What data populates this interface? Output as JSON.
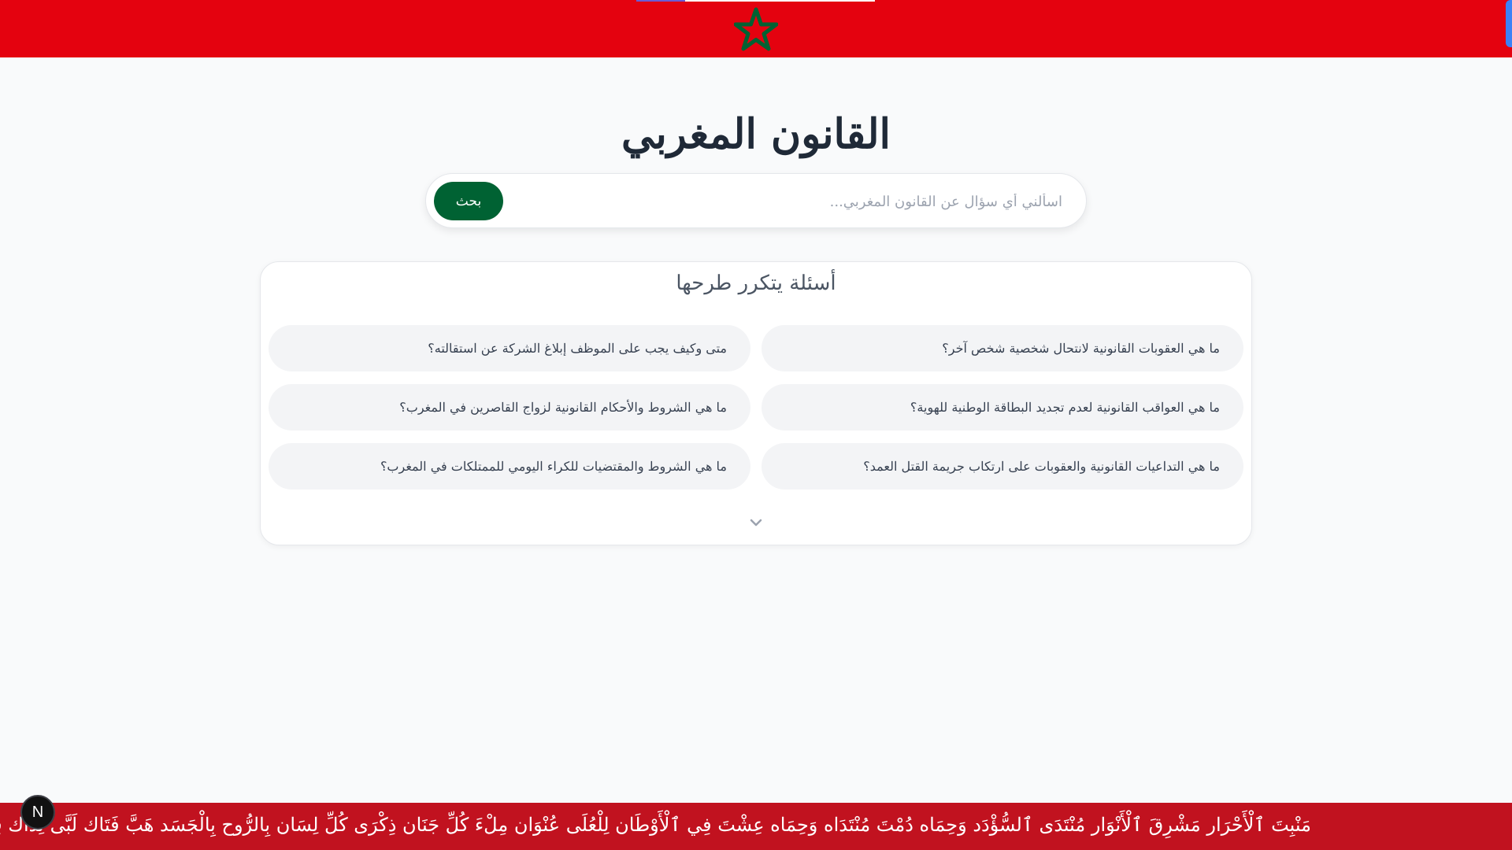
{
  "colors": {
    "banner_red": "#e4020f",
    "star_green": "#006233",
    "button_green": "#006233",
    "ticker_red": "#c1121f",
    "page_bg": "#f9fafb",
    "chip_bg": "#f3f4f6"
  },
  "header": {
    "icon": "star-icon"
  },
  "main": {
    "title": "القانون المغربي"
  },
  "search": {
    "placeholder": "اسألني أي سؤال عن القانون المغربي...",
    "value": "",
    "button_label": "بحث"
  },
  "faq": {
    "title": "أسئلة يتكرر طرحها",
    "questions": [
      "ما هي العقوبات القانونية لانتحال شخصية شخص آخر؟",
      "متى وكيف يجب على الموظف إبلاغ الشركة عن استقالته؟",
      "ما هي العواقب القانونية لعدم تجديد البطاقة الوطنية للهوية؟",
      "ما هي الشروط والأحكام القانونية لزواج القاصرين في المغرب؟",
      "ما هي التداعيات القانونية والعقوبات على ارتكاب جريمة القتل العمد؟",
      "ما هي الشروط والمقتضيات للكراء اليومي للممتلكات في المغرب؟"
    ],
    "expand_icon": "chevron-down-icon"
  },
  "ticker": {
    "text": "مَنْبِتَ ٱلْأَحْرَار مَشْرِقَ ٱلْأَنْوَار مُنْتَدَى ٱلسُّؤْدَد وَحِمَاه دُمْتَ مُنْتَدَاه وَحِمَاه عِشْتَ فِي ٱلْأَوْطَان لِلْعُلَى عُنْوَان مِلْءَ كُلِّ جَنَان ذِكْرَى كُلِّ لِسَان بِالرُّوح بِالْجَسَد هَبَّ فَتَاك لَبَّى نِدَاك فِي فَمِي وَفِي دَمِي هَوَاك ثَارَ نُور وَنَار إِخْوَتِي"
  },
  "avatar": {
    "initial": "N"
  }
}
